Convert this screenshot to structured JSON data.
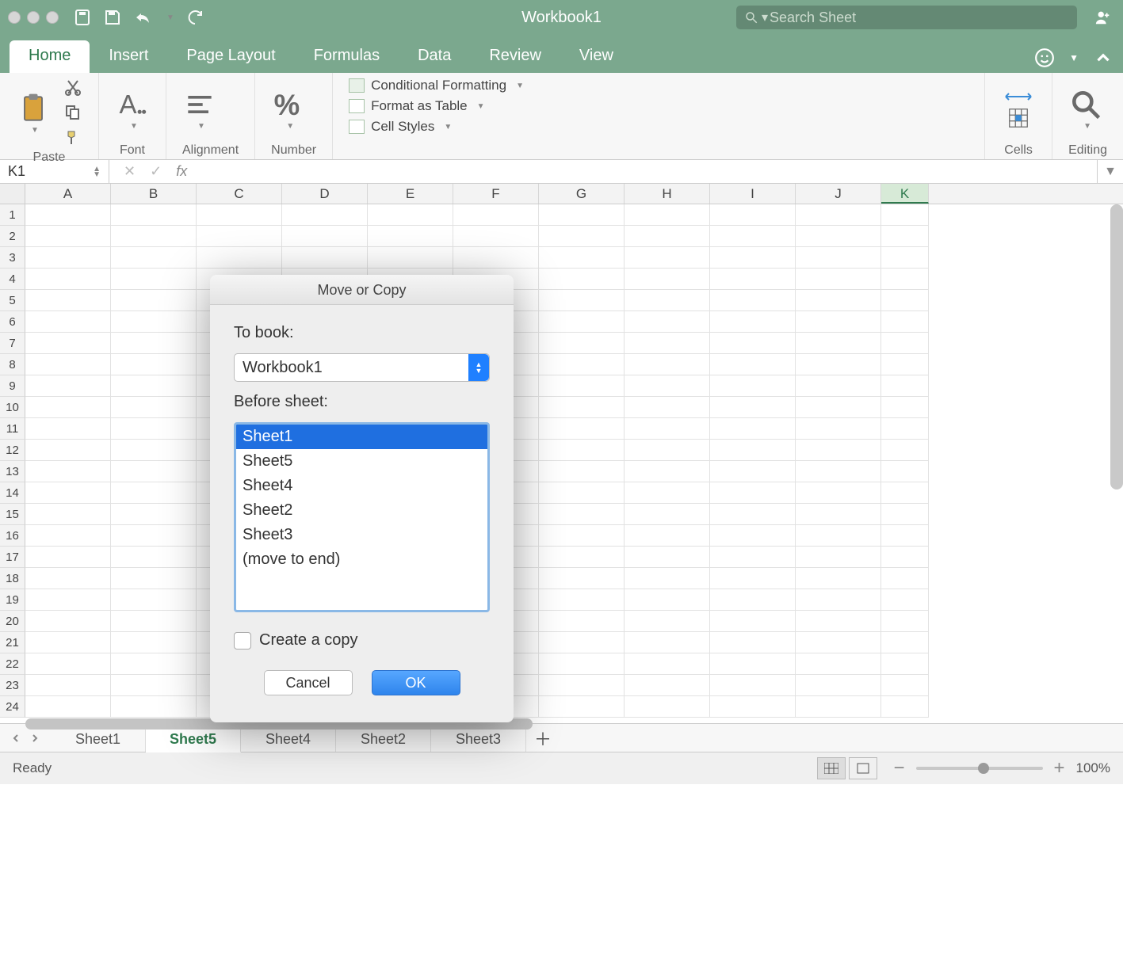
{
  "window": {
    "title": "Workbook1"
  },
  "search": {
    "placeholder": "Search Sheet"
  },
  "ribbon_tabs": [
    "Home",
    "Insert",
    "Page Layout",
    "Formulas",
    "Data",
    "Review",
    "View"
  ],
  "ribbon": {
    "paste": "Paste",
    "font": "Font",
    "alignment": "Alignment",
    "number": "Number",
    "cond_fmt": "Conditional Formatting",
    "fmt_table": "Format as Table",
    "cell_styles": "Cell Styles",
    "cells": "Cells",
    "editing": "Editing"
  },
  "namebox": "K1",
  "columns": [
    "A",
    "B",
    "C",
    "D",
    "E",
    "F",
    "G",
    "H",
    "I",
    "J",
    "K"
  ],
  "rows": [
    "1",
    "2",
    "3",
    "4",
    "5",
    "6",
    "7",
    "8",
    "9",
    "10",
    "11",
    "12",
    "13",
    "14",
    "15",
    "16",
    "17",
    "18",
    "19",
    "20",
    "21",
    "22",
    "23",
    "24"
  ],
  "sheet_tabs": [
    "Sheet1",
    "Sheet5",
    "Sheet4",
    "Sheet2",
    "Sheet3"
  ],
  "active_sheet": "Sheet5",
  "status": {
    "ready": "Ready",
    "zoom": "100%"
  },
  "dialog": {
    "title": "Move or Copy",
    "to_book_label": "To book:",
    "to_book_value": "Workbook1",
    "before_sheet_label": "Before sheet:",
    "list": [
      "Sheet1",
      "Sheet5",
      "Sheet4",
      "Sheet2",
      "Sheet3",
      "(move to end)"
    ],
    "selected": "Sheet1",
    "create_copy": "Create a copy",
    "cancel": "Cancel",
    "ok": "OK"
  }
}
